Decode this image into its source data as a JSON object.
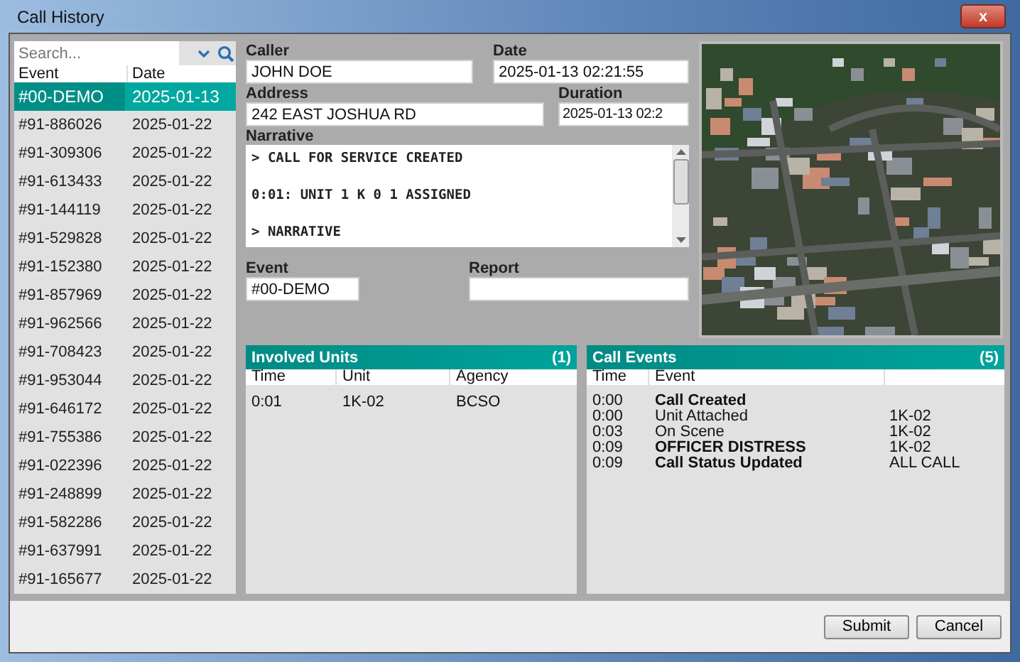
{
  "window": {
    "title": "Call History",
    "close": "x"
  },
  "search": {
    "placeholder": "Search..."
  },
  "calls": {
    "columns": [
      "Event",
      "Date"
    ],
    "rows": [
      {
        "event": "#00-DEMO",
        "date": "2025-01-13",
        "selected": true
      },
      {
        "event": "#91-886026",
        "date": "2025-01-22",
        "selected": false
      },
      {
        "event": "#91-309306",
        "date": "2025-01-22",
        "selected": false
      },
      {
        "event": "#91-613433",
        "date": "2025-01-22",
        "selected": false
      },
      {
        "event": "#91-144119",
        "date": "2025-01-22",
        "selected": false
      },
      {
        "event": "#91-529828",
        "date": "2025-01-22",
        "selected": false
      },
      {
        "event": "#91-152380",
        "date": "2025-01-22",
        "selected": false
      },
      {
        "event": "#91-857969",
        "date": "2025-01-22",
        "selected": false
      },
      {
        "event": "#91-962566",
        "date": "2025-01-22",
        "selected": false
      },
      {
        "event": "#91-708423",
        "date": "2025-01-22",
        "selected": false
      },
      {
        "event": "#91-953044",
        "date": "2025-01-22",
        "selected": false
      },
      {
        "event": "#91-646172",
        "date": "2025-01-22",
        "selected": false
      },
      {
        "event": "#91-755386",
        "date": "2025-01-22",
        "selected": false
      },
      {
        "event": "#91-022396",
        "date": "2025-01-22",
        "selected": false
      },
      {
        "event": "#91-248899",
        "date": "2025-01-22",
        "selected": false
      },
      {
        "event": "#91-582286",
        "date": "2025-01-22",
        "selected": false
      },
      {
        "event": "#91-637991",
        "date": "2025-01-22",
        "selected": false
      },
      {
        "event": "#91-165677",
        "date": "2025-01-22",
        "selected": false
      }
    ]
  },
  "form": {
    "caller": {
      "label": "Caller",
      "value": "JOHN DOE"
    },
    "date": {
      "label": "Date",
      "value": "2025-01-13 02:21:55"
    },
    "address": {
      "label": "Address",
      "value": "242 EAST JOSHUA RD"
    },
    "duration": {
      "label": "Duration",
      "value": "2025-01-13 02:2"
    },
    "narrative": {
      "label": "Narrative",
      "lines": [
        "> CALL FOR SERVICE CREATED",
        "0:01: UNIT 1 K 0 1 ASSIGNED",
        "> NARRATIVE"
      ]
    },
    "event": {
      "label": "Event",
      "value": "#00-DEMO"
    },
    "report": {
      "label": "Report"
    }
  },
  "map": {
    "kind": "picture"
  },
  "involved_units": {
    "title": "Involved Units",
    "count": "(1)",
    "columns": [
      "Time",
      "Unit",
      "Agency"
    ],
    "rows": [
      {
        "time": "0:01",
        "unit": "1K-02",
        "agency": "BCSO"
      }
    ]
  },
  "call_events": {
    "title": "Call Events",
    "count": "(5)",
    "columns": [
      "Time",
      "Event"
    ],
    "rows": [
      {
        "time": "0:00",
        "event": "Call Created",
        "unit": "",
        "bold": true
      },
      {
        "time": "0:00",
        "event": "Unit Attached",
        "unit": "1K-02",
        "bold": false
      },
      {
        "time": "0:03",
        "event": "On Scene",
        "unit": "1K-02",
        "bold": false
      },
      {
        "time": "0:09",
        "event": "OFFICER DISTRESS",
        "unit": "1K-02",
        "bold": true
      },
      {
        "time": "0:09",
        "event": "Call Status Updated",
        "unit": "ALL CALL",
        "bold": true
      }
    ]
  },
  "buttons": [
    "Submit",
    "Cancel"
  ]
}
